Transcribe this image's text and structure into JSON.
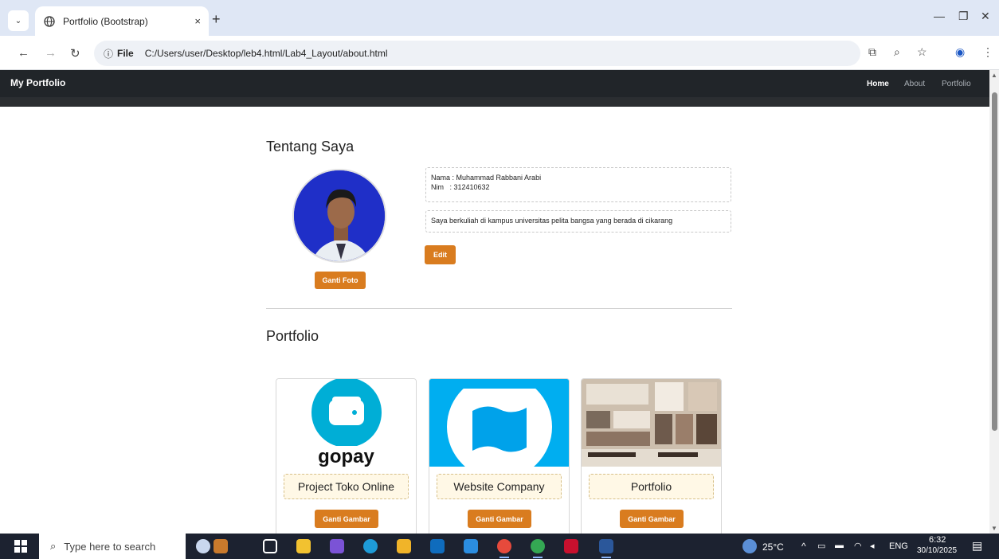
{
  "browser": {
    "tab_title": "Portfolio (Bootstrap)",
    "tab_close": "×",
    "new_tab": "+",
    "site_info": "ⓘ",
    "file_label": "File",
    "url": "C:/Users/user/Desktop/leb4.html/Lab4_Layout/about.html"
  },
  "navbar": {
    "brand": "My Portfolio",
    "links": [
      "Home",
      "About",
      "Portfolio"
    ]
  },
  "about": {
    "title": "Tentang Saya",
    "name_line": "Nama : Muhammad Rabbani Arabi",
    "nim_line": "Nim   : 312410632",
    "bio": "Saya berkuliah di kampus universitas pelita bangsa yang berada di cikarang",
    "edit_button": "Edit",
    "change_photo_button": "Ganti Foto"
  },
  "portfolio": {
    "title": "Portfolio",
    "cards": [
      {
        "caption": "Project Toko Online",
        "button": "Ganti Gambar",
        "logo_text": "gopay"
      },
      {
        "caption": "Website Company",
        "button": "Ganti Gambar"
      },
      {
        "caption": "Portfolio",
        "button": "Ganti Gambar"
      }
    ]
  },
  "taskbar": {
    "search_placeholder": "Type here to search",
    "temperature": "25°C",
    "language": "ENG",
    "time": "6:32",
    "date": "30/10/2025"
  },
  "colors": {
    "accent_orange": "#d97c1f",
    "navbar_bg": "#212529",
    "avatar_bg": "#1f2fc8",
    "gopay_blue": "#00aed6"
  }
}
